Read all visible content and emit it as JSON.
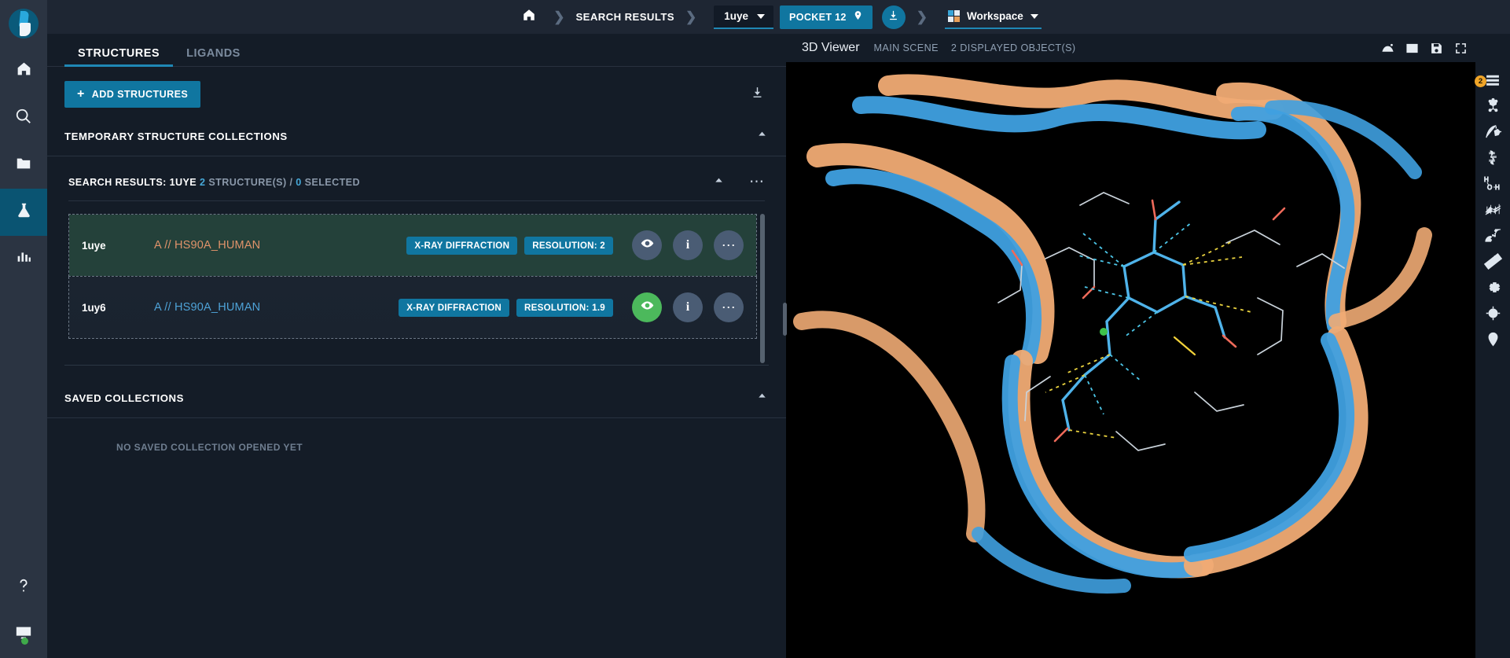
{
  "rail": {
    "logo_name": "app-logo",
    "items": [
      {
        "icon": "home-icon",
        "name": "rail-item-home",
        "active": false
      },
      {
        "icon": "search-icon",
        "name": "rail-item-search",
        "active": false
      },
      {
        "icon": "folder-icon",
        "name": "rail-item-projects",
        "active": false
      },
      {
        "icon": "flask-icon",
        "name": "rail-item-lab",
        "active": true
      },
      {
        "icon": "chart-bars-icon",
        "name": "rail-item-analytics",
        "active": false
      }
    ],
    "bottom": [
      {
        "icon": "help-icon",
        "name": "rail-item-help"
      },
      {
        "icon": "monitor-icon",
        "name": "rail-item-display"
      }
    ]
  },
  "topbar": {
    "home_icon": "home-icon",
    "breadcrumb_search_results": "SEARCH RESULTS",
    "structure_select_value": "1uye",
    "pocket_label": "POCKET 12",
    "pocket_icon": "map-pin-icon",
    "download_icon": "download-icon",
    "workspace_label": "Workspace",
    "workspace_icon": "grid-icon",
    "chevron_icon": "chevron-down-icon"
  },
  "panel": {
    "tabs": [
      {
        "label": "STRUCTURES",
        "active": true
      },
      {
        "label": "LIGANDS",
        "active": false
      }
    ],
    "add_button": "ADD STRUCTURES",
    "add_icon": "plus-icon",
    "download_icon": "download-icon",
    "temporary_section_title": "TEMPORARY STRUCTURE COLLECTIONS",
    "collapse_icon": "chevron-up-icon",
    "group": {
      "title_prefix": "SEARCH RESULTS: 1UYE",
      "count_number": "2",
      "count_text": "STRUCTURE(S) /",
      "selected_number": "0",
      "selected_text": "SELECTED",
      "more_icon": "ellipsis-icon"
    },
    "rows": [
      {
        "id": "1uye",
        "chain": "A // HS90A_HUMAN",
        "chain_color": "orange",
        "badges": [
          "X-RAY DIFFRACTION",
          "RESOLUTION: 2"
        ],
        "selected": true,
        "visible": false,
        "eye_icon": "eye-icon",
        "info_icon": "info-icon",
        "more_icon": "ellipsis-icon"
      },
      {
        "id": "1uy6",
        "chain": "A // HS90A_HUMAN",
        "chain_color": "blue",
        "badges": [
          "X-RAY DIFFRACTION",
          "RESOLUTION: 1.9"
        ],
        "selected": false,
        "visible": true,
        "eye_icon": "eye-icon",
        "info_icon": "info-icon",
        "more_icon": "ellipsis-icon"
      }
    ],
    "saved_section_title": "SAVED COLLECTIONS",
    "saved_empty_text": "NO SAVED COLLECTION OPENED YET"
  },
  "viewer": {
    "title": "3D Viewer",
    "scene_label": "MAIN SCENE",
    "objects_label": "2 DISPLAYED OBJECT(S)",
    "head_icons": [
      {
        "name": "hide-surface-icon"
      },
      {
        "name": "image-export-icon"
      },
      {
        "name": "save-icon"
      },
      {
        "name": "fullscreen-icon"
      }
    ],
    "tools_badge": "2",
    "tools": [
      {
        "name": "menu-icon"
      },
      {
        "name": "molecule-icon"
      },
      {
        "name": "ligand-interaction-icon"
      },
      {
        "name": "ribbon-icon"
      },
      {
        "name": "water-hbond-icon"
      },
      {
        "name": "surface-grid-icon"
      },
      {
        "name": "contacts-icon"
      },
      {
        "name": "ruler-icon"
      },
      {
        "name": "gear-icon"
      },
      {
        "name": "target-icon"
      },
      {
        "name": "pocket-pin-icon"
      }
    ]
  },
  "colors": {
    "accent": "#1076a0",
    "accent_light": "#1f88b5",
    "selected_row": "#24413a",
    "green": "#4cb95c",
    "orange_chain": "#e0936a",
    "blue_chain": "#4ea3d8",
    "badge_orange": "#f0a528"
  }
}
